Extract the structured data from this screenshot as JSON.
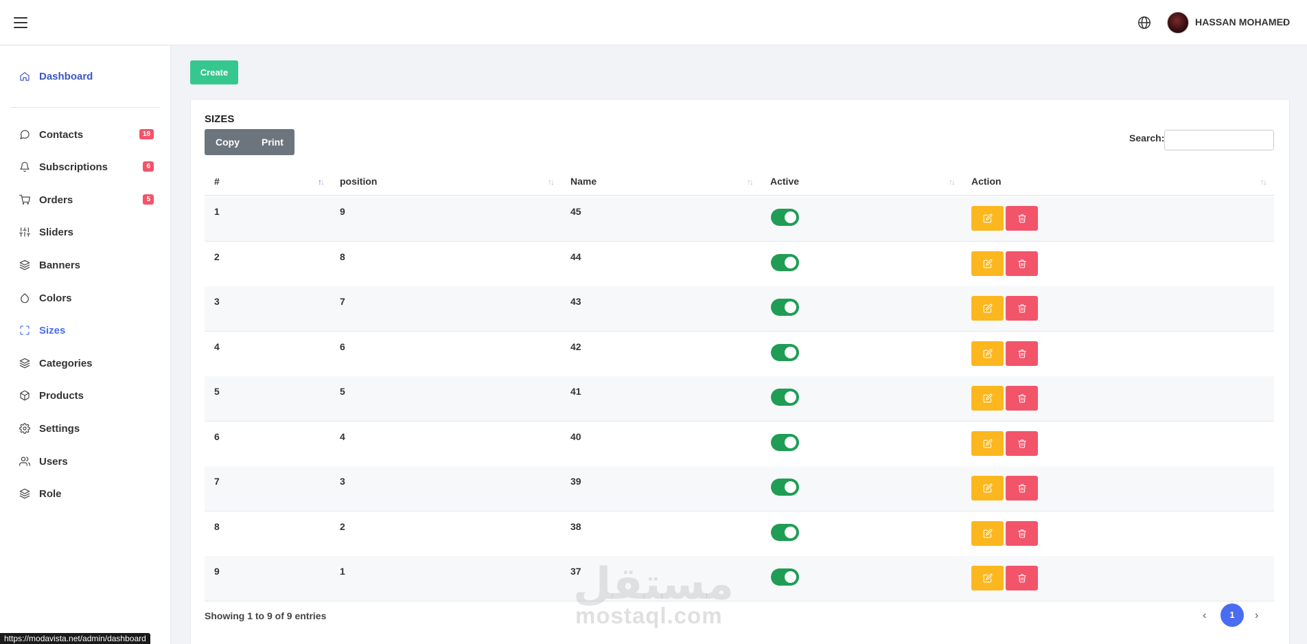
{
  "topbar": {
    "menu_icon": "hamburger-icon",
    "language_icon": "globe-icon",
    "user_name": "HASSAN MOHAMED",
    "user_chevron": "⌄"
  },
  "sidebar": {
    "items": [
      {
        "label": "Dashboard",
        "icon": "home-icon"
      },
      {
        "label": "Contacts",
        "icon": "chat-icon",
        "badge": "18"
      },
      {
        "label": "Subscriptions",
        "icon": "bell-icon",
        "badge": "6"
      },
      {
        "label": "Orders",
        "icon": "cart-icon",
        "badge": "5"
      },
      {
        "label": "Sliders",
        "icon": "sliders-icon"
      },
      {
        "label": "Banners",
        "icon": "layers-icon"
      },
      {
        "label": "Colors",
        "icon": "droplet-icon"
      },
      {
        "label": "Sizes",
        "icon": "maximize-icon"
      },
      {
        "label": "Categories",
        "icon": "layers-icon"
      },
      {
        "label": "Products",
        "icon": "box-icon"
      },
      {
        "label": "Settings",
        "icon": "gear-icon"
      },
      {
        "label": "Users",
        "icon": "users-icon"
      },
      {
        "label": "Role",
        "icon": "layers-icon"
      }
    ]
  },
  "main": {
    "create_label": "Create",
    "card_title": "SIZES",
    "copy_label": "Copy",
    "print_label": "Print",
    "search_label": "Search:",
    "search_value": "",
    "columns": [
      "#",
      "position",
      "Name",
      "Active",
      "Action"
    ],
    "sort_glyph": "↑↓",
    "rows": [
      {
        "id": "1",
        "position": "9",
        "name": "45",
        "active": true
      },
      {
        "id": "2",
        "position": "8",
        "name": "44",
        "active": true
      },
      {
        "id": "3",
        "position": "7",
        "name": "43",
        "active": true
      },
      {
        "id": "4",
        "position": "6",
        "name": "42",
        "active": true
      },
      {
        "id": "5",
        "position": "5",
        "name": "41",
        "active": true
      },
      {
        "id": "6",
        "position": "4",
        "name": "40",
        "active": true
      },
      {
        "id": "7",
        "position": "3",
        "name": "39",
        "active": true
      },
      {
        "id": "8",
        "position": "2",
        "name": "38",
        "active": true
      },
      {
        "id": "9",
        "position": "1",
        "name": "37",
        "active": true
      }
    ],
    "info": "Showing 1 to 9 of 9 entries",
    "pager": {
      "prev": "‹",
      "page": "1",
      "next": "›"
    }
  },
  "watermark": {
    "arabic": "مستقل",
    "latin": "mostaql.com"
  },
  "status_url": "https://modavista.net/admin/dashboard",
  "colors": {
    "create": "#36c78e",
    "edit": "#fbb71d",
    "delete": "#f2546a",
    "toggle_on": "#1f9d55",
    "accent": "#4a6cf0"
  }
}
